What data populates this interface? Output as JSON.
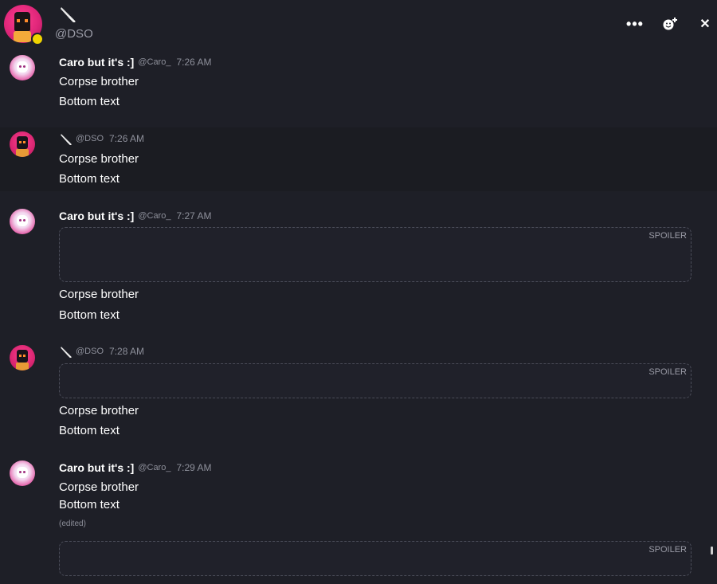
{
  "header": {
    "handle": "@DSO",
    "more_label": "•••",
    "close_label": "✕"
  },
  "messages": [
    {
      "author": "Caro but it's :]",
      "handle": "@Caro_",
      "time": "7:26 AM",
      "lines": [
        "Corpse brother",
        "Bottom text"
      ]
    },
    {
      "author": "",
      "handle": "@DSO",
      "time": "7:26 AM",
      "lines": [
        "Corpse brother",
        "Bottom text"
      ]
    },
    {
      "author": "Caro but it's :]",
      "handle": "@Caro_",
      "time": "7:27 AM",
      "spoiler": "SPOILER",
      "lines": [
        "Corpse brother",
        "Bottom text"
      ]
    },
    {
      "author": "",
      "handle": "@DSO",
      "time": "7:28 AM",
      "spoiler": "SPOILER",
      "lines": [
        "Corpse brother",
        "Bottom text"
      ]
    },
    {
      "author": "Caro but it's :]",
      "handle": "@Caro_",
      "time": "7:29 AM",
      "lines": [
        "Corpse brother",
        "Bottom text"
      ],
      "edited": "(edited)",
      "spoiler": "SPOILER"
    }
  ],
  "icons": {
    "knife": "knife-icon",
    "more": "more-options-icon",
    "add_reaction": "add-reaction-icon",
    "close": "close-icon"
  },
  "colors": {
    "background": "#1e1f27",
    "status_idle": "#f0d400",
    "muted_text": "#8e909b"
  }
}
